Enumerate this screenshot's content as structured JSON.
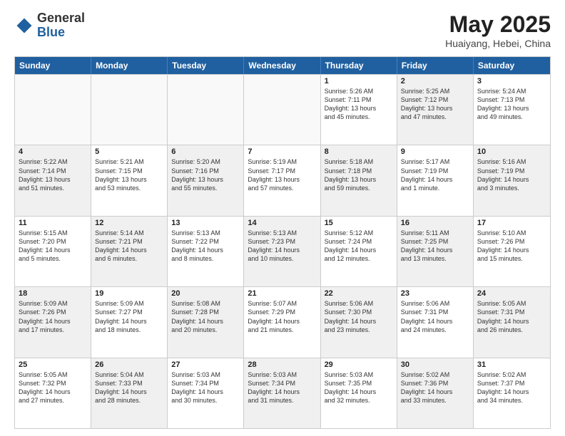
{
  "header": {
    "logo_general": "General",
    "logo_blue": "Blue",
    "month": "May 2025",
    "location": "Huaiyang, Hebei, China"
  },
  "weekdays": [
    "Sunday",
    "Monday",
    "Tuesday",
    "Wednesday",
    "Thursday",
    "Friday",
    "Saturday"
  ],
  "rows": [
    [
      {
        "day": "",
        "text": "",
        "empty": true
      },
      {
        "day": "",
        "text": "",
        "empty": true
      },
      {
        "day": "",
        "text": "",
        "empty": true
      },
      {
        "day": "",
        "text": "",
        "empty": true
      },
      {
        "day": "1",
        "text": "Sunrise: 5:26 AM\nSunset: 7:11 PM\nDaylight: 13 hours\nand 45 minutes."
      },
      {
        "day": "2",
        "text": "Sunrise: 5:25 AM\nSunset: 7:12 PM\nDaylight: 13 hours\nand 47 minutes.",
        "shaded": true
      },
      {
        "day": "3",
        "text": "Sunrise: 5:24 AM\nSunset: 7:13 PM\nDaylight: 13 hours\nand 49 minutes."
      }
    ],
    [
      {
        "day": "4",
        "text": "Sunrise: 5:22 AM\nSunset: 7:14 PM\nDaylight: 13 hours\nand 51 minutes.",
        "shaded": true
      },
      {
        "day": "5",
        "text": "Sunrise: 5:21 AM\nSunset: 7:15 PM\nDaylight: 13 hours\nand 53 minutes."
      },
      {
        "day": "6",
        "text": "Sunrise: 5:20 AM\nSunset: 7:16 PM\nDaylight: 13 hours\nand 55 minutes.",
        "shaded": true
      },
      {
        "day": "7",
        "text": "Sunrise: 5:19 AM\nSunset: 7:17 PM\nDaylight: 13 hours\nand 57 minutes."
      },
      {
        "day": "8",
        "text": "Sunrise: 5:18 AM\nSunset: 7:18 PM\nDaylight: 13 hours\nand 59 minutes.",
        "shaded": true
      },
      {
        "day": "9",
        "text": "Sunrise: 5:17 AM\nSunset: 7:19 PM\nDaylight: 14 hours\nand 1 minute."
      },
      {
        "day": "10",
        "text": "Sunrise: 5:16 AM\nSunset: 7:19 PM\nDaylight: 14 hours\nand 3 minutes.",
        "shaded": true
      }
    ],
    [
      {
        "day": "11",
        "text": "Sunrise: 5:15 AM\nSunset: 7:20 PM\nDaylight: 14 hours\nand 5 minutes."
      },
      {
        "day": "12",
        "text": "Sunrise: 5:14 AM\nSunset: 7:21 PM\nDaylight: 14 hours\nand 6 minutes.",
        "shaded": true
      },
      {
        "day": "13",
        "text": "Sunrise: 5:13 AM\nSunset: 7:22 PM\nDaylight: 14 hours\nand 8 minutes."
      },
      {
        "day": "14",
        "text": "Sunrise: 5:13 AM\nSunset: 7:23 PM\nDaylight: 14 hours\nand 10 minutes.",
        "shaded": true
      },
      {
        "day": "15",
        "text": "Sunrise: 5:12 AM\nSunset: 7:24 PM\nDaylight: 14 hours\nand 12 minutes."
      },
      {
        "day": "16",
        "text": "Sunrise: 5:11 AM\nSunset: 7:25 PM\nDaylight: 14 hours\nand 13 minutes.",
        "shaded": true
      },
      {
        "day": "17",
        "text": "Sunrise: 5:10 AM\nSunset: 7:26 PM\nDaylight: 14 hours\nand 15 minutes."
      }
    ],
    [
      {
        "day": "18",
        "text": "Sunrise: 5:09 AM\nSunset: 7:26 PM\nDaylight: 14 hours\nand 17 minutes.",
        "shaded": true
      },
      {
        "day": "19",
        "text": "Sunrise: 5:09 AM\nSunset: 7:27 PM\nDaylight: 14 hours\nand 18 minutes."
      },
      {
        "day": "20",
        "text": "Sunrise: 5:08 AM\nSunset: 7:28 PM\nDaylight: 14 hours\nand 20 minutes.",
        "shaded": true
      },
      {
        "day": "21",
        "text": "Sunrise: 5:07 AM\nSunset: 7:29 PM\nDaylight: 14 hours\nand 21 minutes."
      },
      {
        "day": "22",
        "text": "Sunrise: 5:06 AM\nSunset: 7:30 PM\nDaylight: 14 hours\nand 23 minutes.",
        "shaded": true
      },
      {
        "day": "23",
        "text": "Sunrise: 5:06 AM\nSunset: 7:31 PM\nDaylight: 14 hours\nand 24 minutes."
      },
      {
        "day": "24",
        "text": "Sunrise: 5:05 AM\nSunset: 7:31 PM\nDaylight: 14 hours\nand 26 minutes.",
        "shaded": true
      }
    ],
    [
      {
        "day": "25",
        "text": "Sunrise: 5:05 AM\nSunset: 7:32 PM\nDaylight: 14 hours\nand 27 minutes."
      },
      {
        "day": "26",
        "text": "Sunrise: 5:04 AM\nSunset: 7:33 PM\nDaylight: 14 hours\nand 28 minutes.",
        "shaded": true
      },
      {
        "day": "27",
        "text": "Sunrise: 5:03 AM\nSunset: 7:34 PM\nDaylight: 14 hours\nand 30 minutes."
      },
      {
        "day": "28",
        "text": "Sunrise: 5:03 AM\nSunset: 7:34 PM\nDaylight: 14 hours\nand 31 minutes.",
        "shaded": true
      },
      {
        "day": "29",
        "text": "Sunrise: 5:03 AM\nSunset: 7:35 PM\nDaylight: 14 hours\nand 32 minutes."
      },
      {
        "day": "30",
        "text": "Sunrise: 5:02 AM\nSunset: 7:36 PM\nDaylight: 14 hours\nand 33 minutes.",
        "shaded": true
      },
      {
        "day": "31",
        "text": "Sunrise: 5:02 AM\nSunset: 7:37 PM\nDaylight: 14 hours\nand 34 minutes."
      }
    ]
  ]
}
